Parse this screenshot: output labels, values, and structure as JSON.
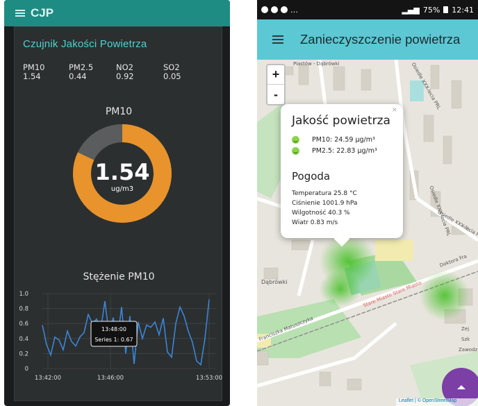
{
  "left_app": {
    "app_name": "CJP",
    "card_title": "Czujnik Jakości Powietrza",
    "metrics": [
      {
        "name": "PM10",
        "value": "1.54"
      },
      {
        "name": "PM2.5",
        "value": "0.44"
      },
      {
        "name": "NO2",
        "value": "0.92"
      },
      {
        "name": "SO2",
        "value": "0.05"
      }
    ],
    "gauge": {
      "title": "PM10",
      "value": "1.54",
      "unit": "ug/m3",
      "fill_fraction": 0.82,
      "fill_color": "#e8932b",
      "track_color": "#5a5c5d"
    },
    "chart_title": "Stężenie PM10",
    "tooltip": {
      "time": "13:48:00",
      "label": "Series 1: 0.67"
    }
  },
  "chart_data": {
    "type": "line",
    "title": "Stężenie PM10",
    "xlabel": "",
    "ylabel": "",
    "ylim": [
      0,
      1.0
    ],
    "y_ticks": [
      "0",
      "0.2",
      "0.4",
      "0.6",
      "0.8",
      "1.0"
    ],
    "x_ticks": [
      "13:42:00",
      "13:46:00",
      "13:53:00"
    ],
    "series": [
      {
        "color": "#3a86d6",
        "values": [
          0.58,
          0.32,
          0.18,
          0.42,
          0.38,
          0.25,
          0.5,
          0.36,
          0.3,
          0.42,
          0.48,
          0.72,
          0.6,
          0.66,
          0.52,
          0.9,
          0.45,
          0.68,
          0.38,
          0.82,
          0.2,
          0.7,
          0.06,
          0.62,
          0.4,
          0.58,
          0.55,
          0.62,
          0.45,
          0.67,
          0.22,
          0.15,
          0.6,
          0.82,
          0.7,
          0.5,
          0.35,
          0.1,
          0.05,
          0.4,
          0.92
        ]
      }
    ],
    "grid": true
  },
  "right_app": {
    "statusbar": {
      "time": "12:41",
      "battery": "75%"
    },
    "title": "Zanieczyszczenie powietrza",
    "zoom_in": "+",
    "zoom_out": "-",
    "popup": {
      "close": "×",
      "aq_heading": "Jakość powietrza",
      "pm10": "PM10: 24.59 μg/m³",
      "pm25": "PM2.5: 22.83 μg/m³",
      "weather_heading": "Pogoda",
      "temperature": "Temperatura 25.8 °C",
      "pressure": "Ciśnienie 1001.9 hPa",
      "humidity": "Wilgotność 40.3 %",
      "wind": "Wiatr 0.83 m/s"
    },
    "map_labels": {
      "district1": "Piastów - Dąbrówki",
      "district2": "Dąbrówki",
      "street1": "Doktora Fra",
      "street2": "Franciszka Matuszczyka",
      "street3": "Stare Miasto Stare Miasto",
      "estate1": "Osiedle XXX-lecia PRL",
      "estate2": "Osiedle XXX-lecia P",
      "estate3": "Osiedle XXX-lecia PRL",
      "area1": "Zawodz",
      "area2": "Szk",
      "area3": "Zej"
    },
    "attribution": "Leaflet | © OpenStreetMap"
  }
}
